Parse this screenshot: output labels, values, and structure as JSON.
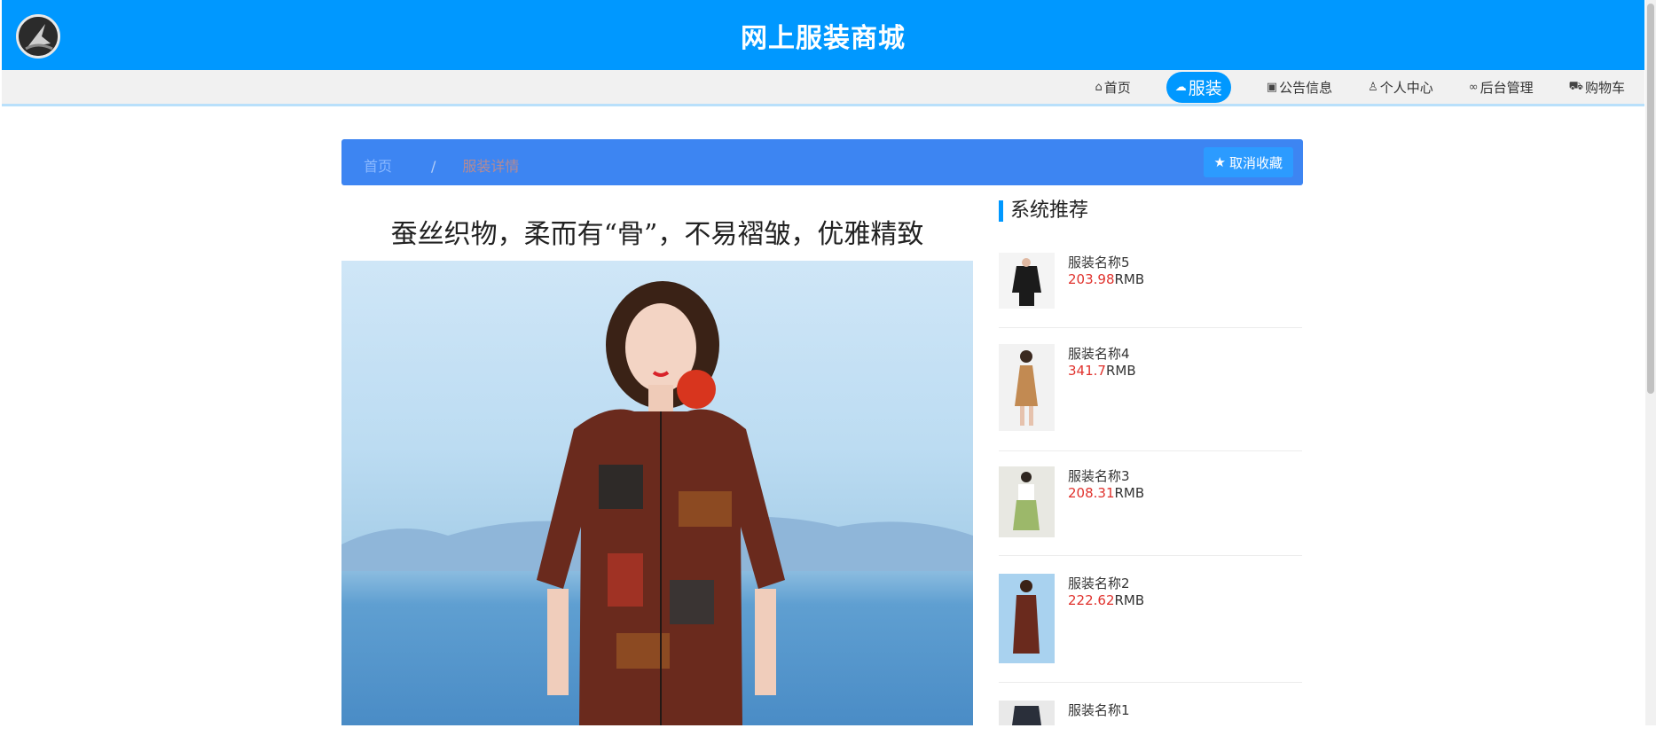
{
  "header": {
    "site_title": "网上服装商城"
  },
  "nav": {
    "items": [
      {
        "label": "首页",
        "icon": "home-icon",
        "active": false
      },
      {
        "label": "服装",
        "icon": "cloud-icon",
        "active": true
      },
      {
        "label": "公告信息",
        "icon": "gift-icon",
        "active": false
      },
      {
        "label": "个人中心",
        "icon": "user-icon",
        "active": false
      },
      {
        "label": "后台管理",
        "icon": "link-icon",
        "active": false
      },
      {
        "label": "购物车",
        "icon": "cart-icon",
        "active": false
      }
    ]
  },
  "breadcrumb": {
    "home": "首页",
    "separator": "/",
    "current": "服装详情"
  },
  "favorite_button": {
    "label": "取消收藏",
    "icon": "star-icon"
  },
  "product": {
    "caption": "蚕丝织物，柔而有“骨”，不易褶皱，优雅精致"
  },
  "sidebar": {
    "title": "系统推荐",
    "items": [
      {
        "name": "服装名称5",
        "price": "203.98",
        "unit": "RMB"
      },
      {
        "name": "服装名称4",
        "price": "341.7",
        "unit": "RMB"
      },
      {
        "name": "服装名称3",
        "price": "208.31",
        "unit": "RMB"
      },
      {
        "name": "服装名称2",
        "price": "222.62",
        "unit": "RMB"
      },
      {
        "name": "服装名称1",
        "price": "",
        "unit": ""
      }
    ]
  },
  "colors": {
    "primary": "#0098ff",
    "crumb_bar": "#3d85f2",
    "price": "#e0322d"
  }
}
